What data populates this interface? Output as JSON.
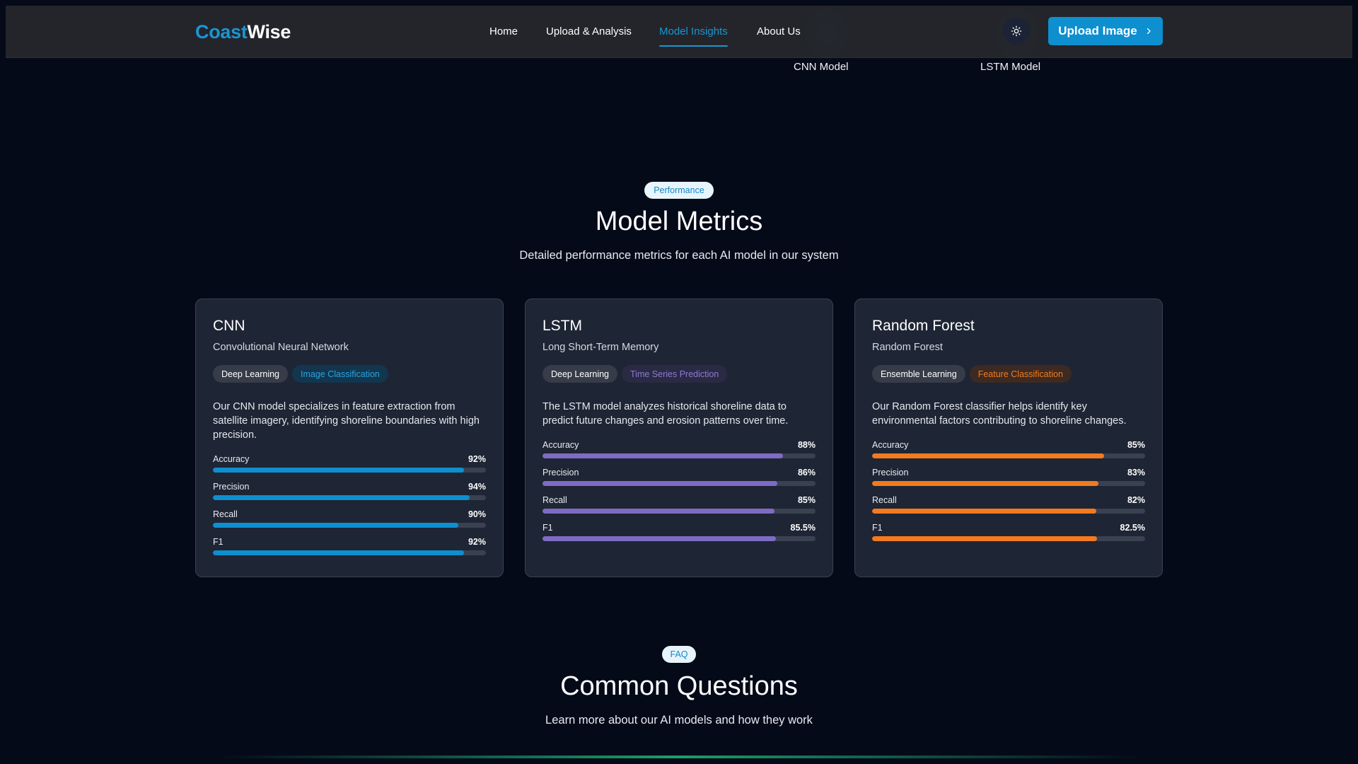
{
  "colors": {
    "accent": "#1b95d3",
    "cnn": "#0e8fcf",
    "lstm": "#7f6bc4",
    "rf": "#f37a1f"
  },
  "background_labels": [
    "CNN Model",
    "LSTM Model"
  ],
  "header": {
    "logo_part1": "Coast",
    "logo_part2": "Wise",
    "nav": [
      {
        "label": "Home"
      },
      {
        "label": "Upload & Analysis"
      },
      {
        "label": "Model Insights",
        "active": true
      },
      {
        "label": "About Us"
      }
    ],
    "theme_icon": "sun-icon",
    "upload_label": "Upload Image",
    "upload_icon": "chevron-right-icon"
  },
  "metrics_section": {
    "badge": "Performance",
    "title": "Model Metrics",
    "subtitle": "Detailed performance metrics for each AI model in our system"
  },
  "models": [
    {
      "name": "CNN",
      "full_name": "Convolutional Neural Network",
      "tags": [
        "Deep Learning",
        "Image Classification"
      ],
      "description": "Our CNN model specializes in feature extraction from satellite imagery, identifying shoreline boundaries with high precision.",
      "metrics": [
        {
          "label": "Accuracy",
          "value": "92%",
          "fraction": 0.92
        },
        {
          "label": "Precision",
          "value": "94%",
          "fraction": 0.94
        },
        {
          "label": "Recall",
          "value": "90%",
          "fraction": 0.9
        },
        {
          "label": "F1",
          "value": "92%",
          "fraction": 0.92
        }
      ]
    },
    {
      "name": "LSTM",
      "full_name": "Long Short-Term Memory",
      "tags": [
        "Deep Learning",
        "Time Series Prediction"
      ],
      "description": "The LSTM model analyzes historical shoreline data to predict future changes and erosion patterns over time.",
      "metrics": [
        {
          "label": "Accuracy",
          "value": "88%",
          "fraction": 0.88
        },
        {
          "label": "Precision",
          "value": "86%",
          "fraction": 0.86
        },
        {
          "label": "Recall",
          "value": "85%",
          "fraction": 0.85
        },
        {
          "label": "F1",
          "value": "85.5%",
          "fraction": 0.855
        }
      ]
    },
    {
      "name": "Random Forest",
      "full_name": "Random Forest",
      "tags": [
        "Ensemble Learning",
        "Feature Classification"
      ],
      "description": "Our Random Forest classifier helps identify key environmental factors contributing to shoreline changes.",
      "metrics": [
        {
          "label": "Accuracy",
          "value": "85%",
          "fraction": 0.85
        },
        {
          "label": "Precision",
          "value": "83%",
          "fraction": 0.83
        },
        {
          "label": "Recall",
          "value": "82%",
          "fraction": 0.82
        },
        {
          "label": "F1",
          "value": "82.5%",
          "fraction": 0.825
        }
      ]
    }
  ],
  "faq_section": {
    "badge": "FAQ",
    "title": "Common Questions",
    "subtitle": "Learn more about our AI models and how they work"
  }
}
